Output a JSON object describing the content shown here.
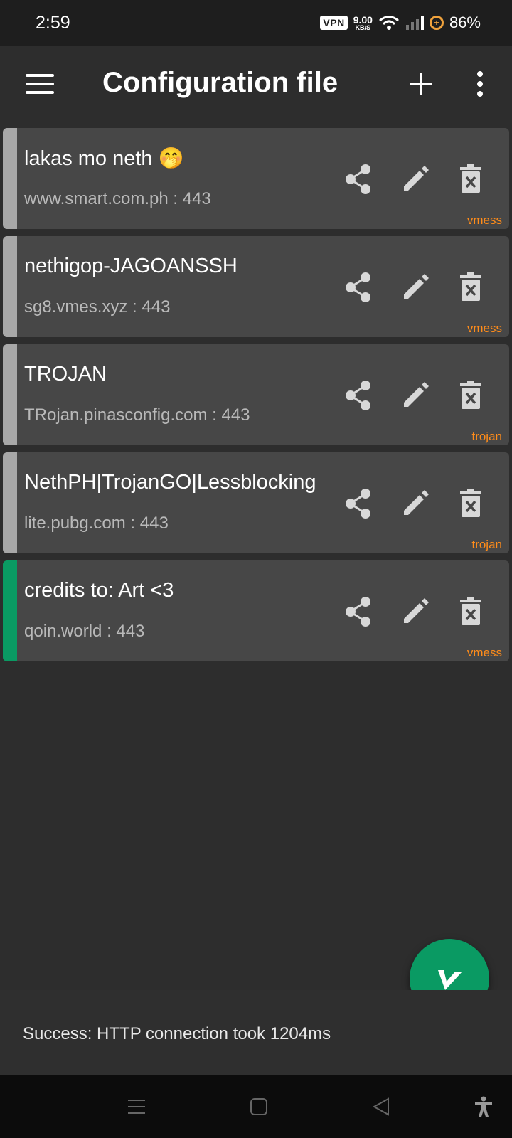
{
  "status_bar": {
    "time": "2:59",
    "vpn": "VPN",
    "speed_value": "9.00",
    "speed_unit": "KB/S",
    "battery": "86%"
  },
  "app_bar": {
    "title": "Configuration file"
  },
  "configs": [
    {
      "name": "lakas mo neth 🤭",
      "address": "www.smart.com.ph : 443",
      "type": "vmess",
      "active": false
    },
    {
      "name": "nethigop-JAGOANSSH",
      "address": "sg8.vmes.xyz : 443",
      "type": "vmess",
      "active": false
    },
    {
      "name": "TROJAN",
      "address": "TRojan.pinasconfig.com : 443",
      "type": "trojan",
      "active": false
    },
    {
      "name": "NethPH|TrojanGO|Lessblocking",
      "address": "lite.pubg.com : 443",
      "type": "trojan",
      "active": false
    },
    {
      "name": "credits to: Art <3",
      "address": "qoin.world : 443",
      "type": "vmess",
      "active": true
    }
  ],
  "test_result": "Success: HTTP connection took 1204ms",
  "colors": {
    "accent": "#0a9a63",
    "type_label": "#ff8c1a",
    "card": "#474747",
    "background": "#2d2d2d"
  },
  "icons": [
    "menu-icon",
    "add-icon",
    "more-vert-icon",
    "share-icon",
    "edit-icon",
    "delete-icon",
    "v-logo-icon",
    "nav-recents-icon",
    "nav-home-icon",
    "nav-back-icon",
    "accessibility-icon"
  ]
}
